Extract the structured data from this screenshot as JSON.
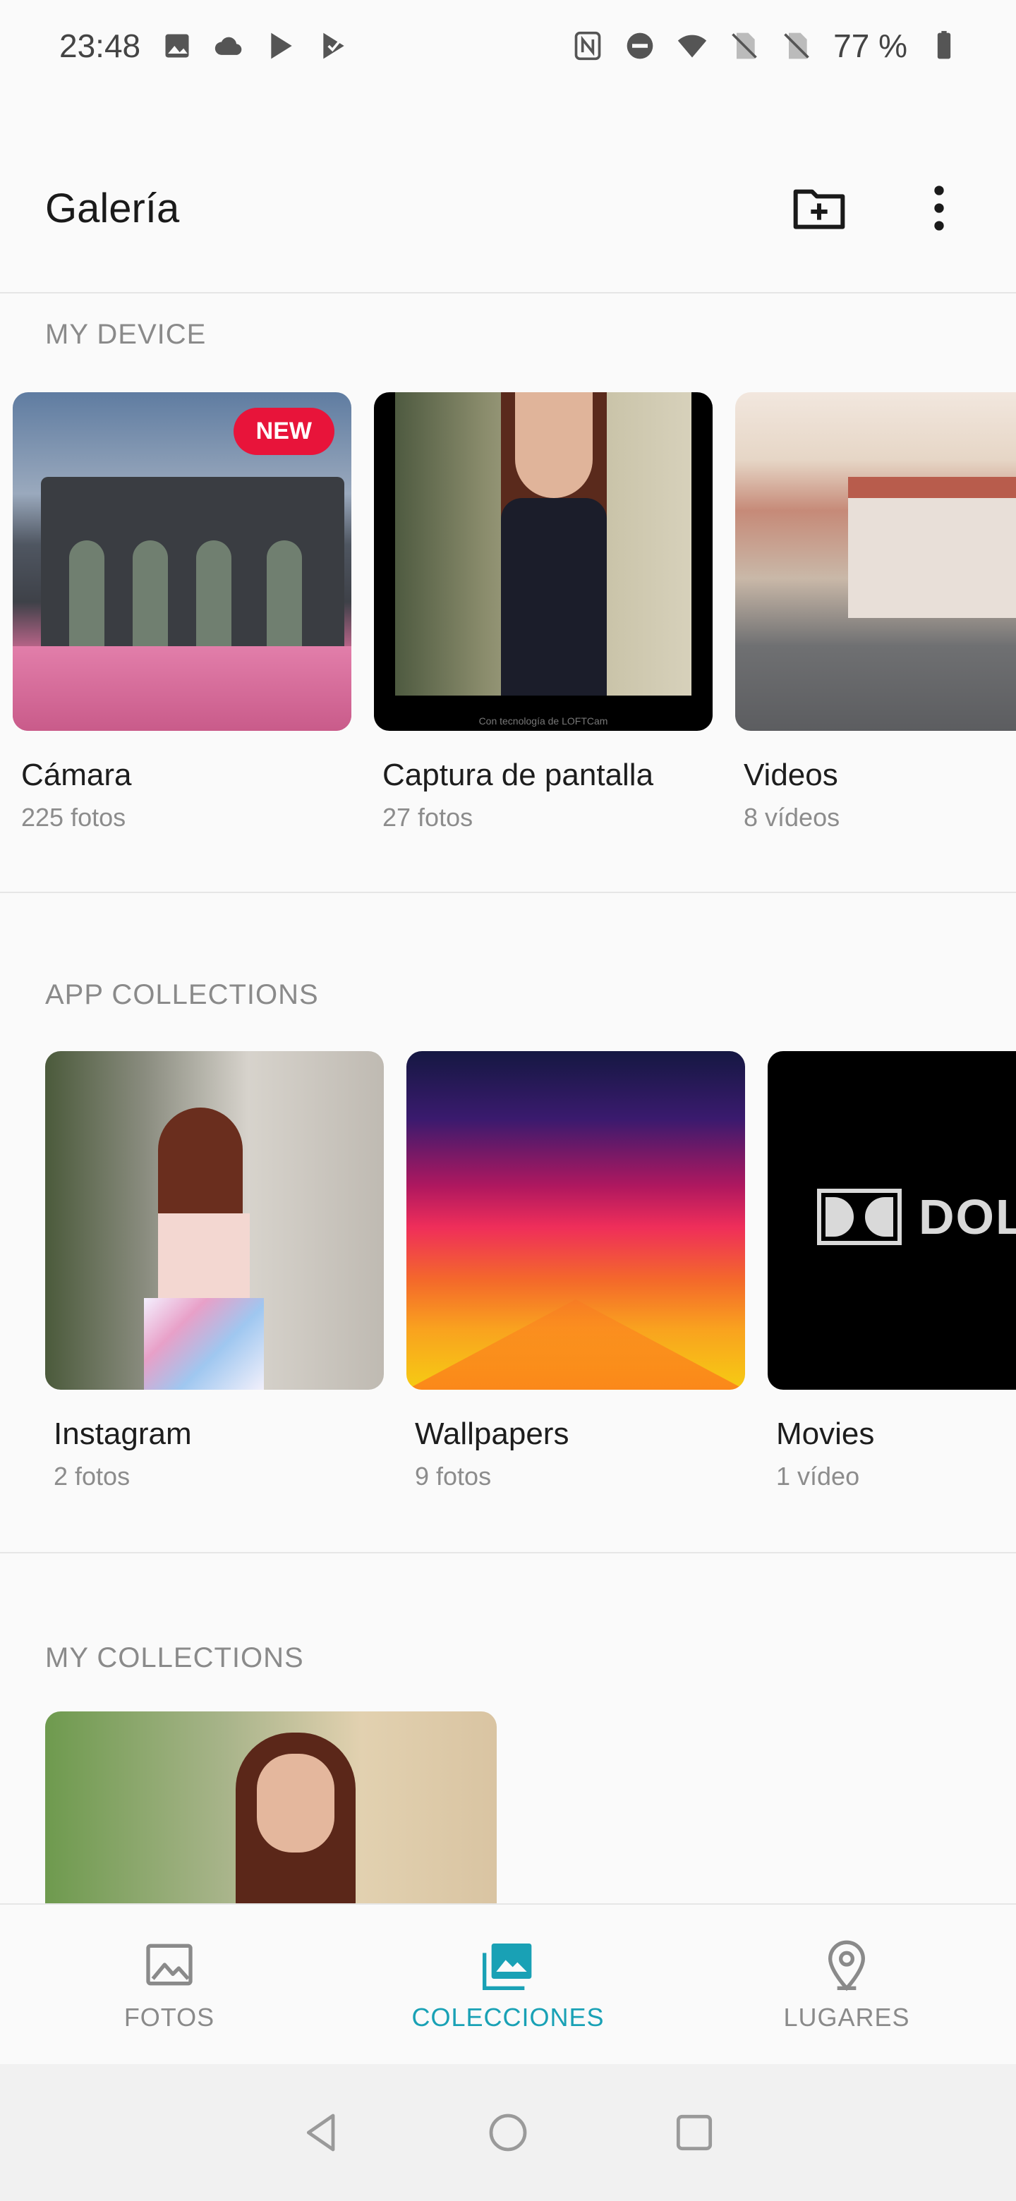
{
  "status": {
    "time": "23:48",
    "battery": "77 %"
  },
  "app_bar": {
    "title": "Galería"
  },
  "sections": {
    "my_device": {
      "label": "MY DEVICE",
      "albums": [
        {
          "name": "Cámara",
          "count": "225 fotos",
          "badge": "NEW"
        },
        {
          "name": "Captura de pantalla",
          "count": "27 fotos",
          "thumb_caption": "Con tecnología de LOFTCam"
        },
        {
          "name": "Videos",
          "count": "8 vídeos"
        }
      ]
    },
    "app_collections": {
      "label": "APP COLLECTIONS",
      "albums": [
        {
          "name": "Instagram",
          "count": "2 fotos"
        },
        {
          "name": "Wallpapers",
          "count": "9 fotos"
        },
        {
          "name": "Movies",
          "count": "1 vídeo",
          "thumb_text": "DOLBY"
        }
      ]
    },
    "my_collections": {
      "label": "MY COLLECTIONS"
    }
  },
  "bottom_nav": {
    "items": [
      {
        "label": "FOTOS",
        "icon": "image-icon",
        "active": false
      },
      {
        "label": "COLECCIONES",
        "icon": "collections-icon",
        "active": true
      },
      {
        "label": "LUGARES",
        "icon": "location-pin-icon",
        "active": false
      }
    ]
  },
  "colors": {
    "accent": "#19a1b5",
    "badge": "#e8143a"
  }
}
